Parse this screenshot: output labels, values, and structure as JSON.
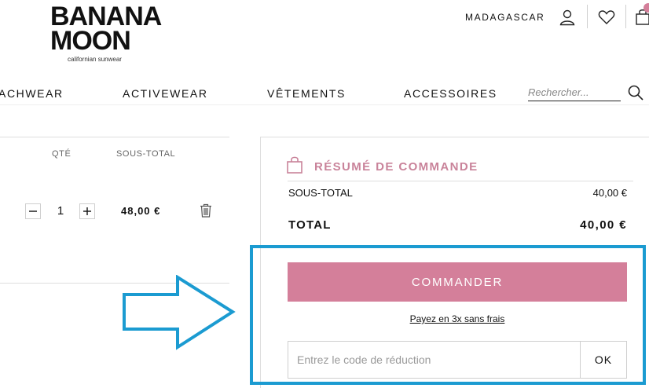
{
  "brand": {
    "name_line1": "BANANA",
    "name_line2": "MOON",
    "tagline": "californian sunwear"
  },
  "header": {
    "country": "MADAGASCAR",
    "icons": [
      "user-icon",
      "heart-icon",
      "bag-icon"
    ]
  },
  "nav": {
    "items": [
      "ACHWEAR",
      "ACTIVEWEAR",
      "VÊTEMENTS",
      "ACCESSOIRES"
    ],
    "search_placeholder": "Rechercher..."
  },
  "cart": {
    "columns": {
      "qty": "QTÉ",
      "subtotal": "SOUS-TOTAL"
    },
    "row": {
      "qty": "1",
      "subtotal": "48,00 €"
    }
  },
  "summary": {
    "title": "RÉSUMÉ DE COMMANDE",
    "subtotal_label": "SOUS-TOTAL",
    "subtotal_value": "40,00 €",
    "total_label": "TOTAL",
    "total_value": "40,00 €",
    "cta_label": "COMMANDER",
    "pay_link": "Payez en 3x sans frais",
    "promo_placeholder": "Entrez le code de réduction",
    "promo_button": "OK"
  },
  "colors": {
    "accent": "#d47f9a",
    "title_pink": "#c9839a",
    "highlight": "#1b9bd1"
  }
}
